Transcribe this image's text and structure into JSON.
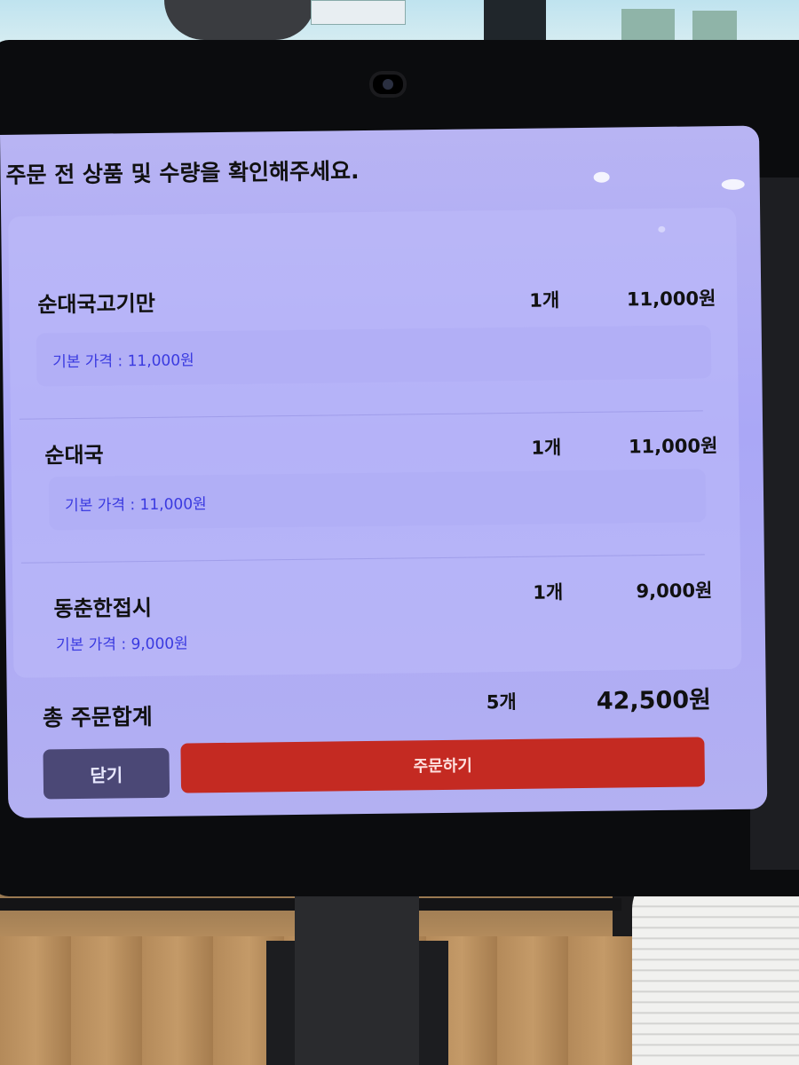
{
  "header": {
    "title": "주문 전 상품 및 수량을 확인해주세요."
  },
  "items": [
    {
      "name": "순대국고기만",
      "qty": "1개",
      "price": "11,000원",
      "base_price": "기본 가격 : 11,000원"
    },
    {
      "name": "순대국",
      "qty": "1개",
      "price": "11,000원",
      "base_price": "기본 가격 : 11,000원"
    },
    {
      "name": "동춘한접시",
      "qty": "1개",
      "price": "9,000원",
      "base_price": "기본 가격 : 9,000원"
    }
  ],
  "total": {
    "label": "총 주문합계",
    "qty": "5개",
    "price": "42,500원"
  },
  "buttons": {
    "close": "닫기",
    "order": "주문하기"
  },
  "colors": {
    "screen_bg": "#aaa7f6",
    "base_price_text": "#3a3ae0",
    "close_button": "#4b4876",
    "order_button": "#c42a22"
  }
}
